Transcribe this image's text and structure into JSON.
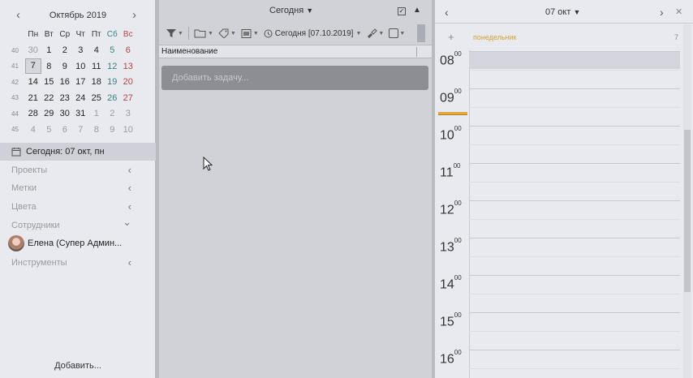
{
  "calendar": {
    "month_title": "Октябрь 2019",
    "weekdays": [
      "Пн",
      "Вт",
      "Ср",
      "Чт",
      "Пт",
      "Сб",
      "Вс"
    ],
    "weeks": [
      {
        "num": "40",
        "days": [
          "30",
          "1",
          "2",
          "3",
          "4",
          "5",
          "6"
        ]
      },
      {
        "num": "41",
        "days": [
          "7",
          "8",
          "9",
          "10",
          "11",
          "12",
          "13"
        ]
      },
      {
        "num": "42",
        "days": [
          "14",
          "15",
          "16",
          "17",
          "18",
          "19",
          "20"
        ]
      },
      {
        "num": "43",
        "days": [
          "21",
          "22",
          "23",
          "24",
          "25",
          "26",
          "27"
        ]
      },
      {
        "num": "44",
        "days": [
          "28",
          "29",
          "30",
          "31",
          "1",
          "2",
          "3"
        ]
      },
      {
        "num": "45",
        "days": [
          "4",
          "5",
          "6",
          "7",
          "8",
          "9",
          "10"
        ]
      }
    ]
  },
  "sidebar": {
    "today_label": "Сегодня: 07 окт, пн",
    "items": [
      {
        "label": "Проекты",
        "chevron": "‹"
      },
      {
        "label": "Метки",
        "chevron": "‹"
      },
      {
        "label": "Цвета",
        "chevron": "‹"
      },
      {
        "label": "Сотрудники",
        "chevron": "⌄"
      },
      {
        "label": "Инструменты",
        "chevron": "‹"
      }
    ],
    "user_label": "Елена (Супер Админ...",
    "add_label": "Добавить..."
  },
  "tasks": {
    "header_title": "Сегодня",
    "checkbox_mark": "✓",
    "date_filter": "Сегодня [07.10.2019]",
    "column_name": "Наименование",
    "add_placeholder": "Добавить задачу..."
  },
  "day_view": {
    "date_title": "07 окт",
    "day_name": "понедельник",
    "day_number": "7",
    "hours": [
      "08",
      "09",
      "10",
      "11",
      "12",
      "13",
      "14",
      "15",
      "16"
    ],
    "minutes": "00"
  },
  "colors": {
    "accent": "#e0a844",
    "sat": "#3a7f7f",
    "sun": "#b04646"
  }
}
